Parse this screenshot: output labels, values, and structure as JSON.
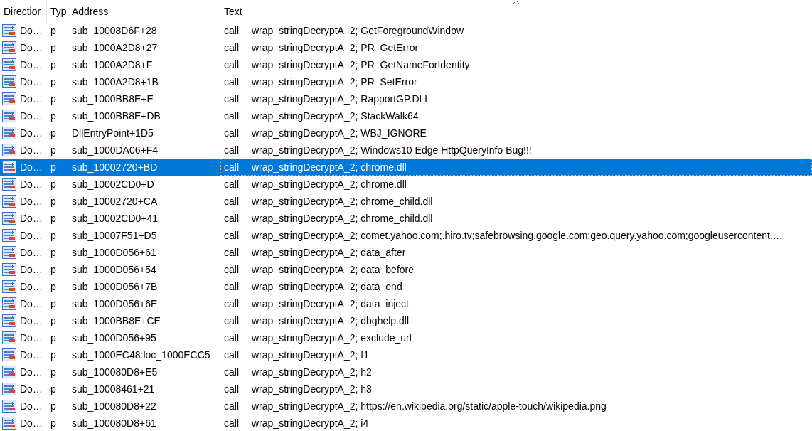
{
  "table": {
    "columns": [
      {
        "label": "Directior",
        "sorted": false
      },
      {
        "label": "Typ",
        "sorted": false
      },
      {
        "label": "Address",
        "sorted": false
      },
      {
        "label": "Text",
        "sorted": true
      }
    ],
    "rows": [
      {
        "direction": "Do…",
        "type": "p",
        "address": "sub_10008D6F+28",
        "mnemonic": "call",
        "operand": "wrap_stringDecryptA_2; GetForegroundWindow",
        "selected": false
      },
      {
        "direction": "Do…",
        "type": "p",
        "address": "sub_1000A2D8+27",
        "mnemonic": "call",
        "operand": "wrap_stringDecryptA_2; PR_GetError",
        "selected": false
      },
      {
        "direction": "Do…",
        "type": "p",
        "address": "sub_1000A2D8+F",
        "mnemonic": "call",
        "operand": "wrap_stringDecryptA_2; PR_GetNameForIdentity",
        "selected": false
      },
      {
        "direction": "Do…",
        "type": "p",
        "address": "sub_1000A2D8+1B",
        "mnemonic": "call",
        "operand": "wrap_stringDecryptA_2; PR_SetError",
        "selected": false
      },
      {
        "direction": "Do…",
        "type": "p",
        "address": "sub_1000BB8E+E",
        "mnemonic": "call",
        "operand": "wrap_stringDecryptA_2; RapportGP.DLL",
        "selected": false
      },
      {
        "direction": "Do…",
        "type": "p",
        "address": "sub_1000BB8E+DB",
        "mnemonic": "call",
        "operand": "wrap_stringDecryptA_2; StackWalk64",
        "selected": false
      },
      {
        "direction": "Do…",
        "type": "p",
        "address": "DllEntryPoint+1D5",
        "mnemonic": "call",
        "operand": "wrap_stringDecryptA_2; WBJ_IGNORE",
        "selected": false
      },
      {
        "direction": "Do…",
        "type": "p",
        "address": "sub_1000DA06+F4",
        "mnemonic": "call",
        "operand": "wrap_stringDecryptA_2; Windows10 Edge HttpQueryInfo Bug!!!",
        "selected": false
      },
      {
        "direction": "Do…",
        "type": "p",
        "address": "sub_10002720+BD",
        "mnemonic": "call",
        "operand": "wrap_stringDecryptA_2; chrome.dll",
        "selected": true
      },
      {
        "direction": "Do…",
        "type": "p",
        "address": "sub_10002CD0+D",
        "mnemonic": "call",
        "operand": "wrap_stringDecryptA_2; chrome.dll",
        "selected": false
      },
      {
        "direction": "Do…",
        "type": "p",
        "address": "sub_10002720+CA",
        "mnemonic": "call",
        "operand": "wrap_stringDecryptA_2; chrome_child.dll",
        "selected": false
      },
      {
        "direction": "Do…",
        "type": "p",
        "address": "sub_10002CD0+41",
        "mnemonic": "call",
        "operand": "wrap_stringDecryptA_2; chrome_child.dll",
        "selected": false
      },
      {
        "direction": "Do…",
        "type": "p",
        "address": "sub_10007F51+D5",
        "mnemonic": "call",
        "operand": "wrap_stringDecryptA_2; comet.yahoo.com;.hiro.tv;safebrowsing.google.com;geo.query.yahoo.com;googleusercontent.…",
        "selected": false
      },
      {
        "direction": "Do…",
        "type": "p",
        "address": "sub_1000D056+61",
        "mnemonic": "call",
        "operand": "wrap_stringDecryptA_2; data_after",
        "selected": false
      },
      {
        "direction": "Do…",
        "type": "p",
        "address": "sub_1000D056+54",
        "mnemonic": "call",
        "operand": "wrap_stringDecryptA_2; data_before",
        "selected": false
      },
      {
        "direction": "Do…",
        "type": "p",
        "address": "sub_1000D056+7B",
        "mnemonic": "call",
        "operand": "wrap_stringDecryptA_2; data_end",
        "selected": false
      },
      {
        "direction": "Do…",
        "type": "p",
        "address": "sub_1000D056+6E",
        "mnemonic": "call",
        "operand": "wrap_stringDecryptA_2; data_inject",
        "selected": false
      },
      {
        "direction": "Do…",
        "type": "p",
        "address": "sub_1000BB8E+CE",
        "mnemonic": "call",
        "operand": "wrap_stringDecryptA_2; dbghelp.dll",
        "selected": false
      },
      {
        "direction": "Do…",
        "type": "p",
        "address": "sub_1000D056+95",
        "mnemonic": "call",
        "operand": "wrap_stringDecryptA_2; exclude_url",
        "selected": false
      },
      {
        "direction": "Do…",
        "type": "p",
        "address": "sub_1000EC48:loc_1000ECC5",
        "mnemonic": "call",
        "operand": "wrap_stringDecryptA_2; f1",
        "selected": false
      },
      {
        "direction": "Do…",
        "type": "p",
        "address": "sub_100080D8+E5",
        "mnemonic": "call",
        "operand": "wrap_stringDecryptA_2; h2",
        "selected": false
      },
      {
        "direction": "Do…",
        "type": "p",
        "address": "sub_10008461+21",
        "mnemonic": "call",
        "operand": "wrap_stringDecryptA_2; h3",
        "selected": false
      },
      {
        "direction": "Do…",
        "type": "p",
        "address": "sub_100080D8+22",
        "mnemonic": "call",
        "operand": "wrap_stringDecryptA_2; https://en.wikipedia.org/static/apple-touch/wikipedia.png",
        "selected": false
      },
      {
        "direction": "Do…",
        "type": "p",
        "address": "sub_100080D8+61",
        "mnemonic": "call",
        "operand": "wrap_stringDecryptA_2; i4",
        "selected": false
      }
    ]
  }
}
